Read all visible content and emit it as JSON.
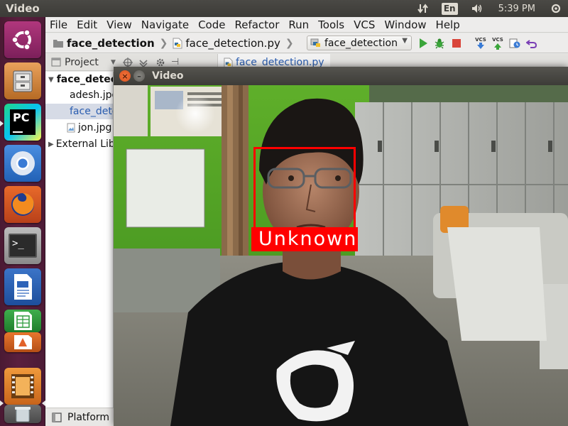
{
  "top_panel": {
    "title": "Video",
    "lang": "En",
    "time": "5:39 PM"
  },
  "launcher": {
    "items": [
      {
        "name": "dash-home",
        "icon": "ubuntu-logo-icon"
      },
      {
        "name": "files",
        "icon": "file-cabinet-icon"
      },
      {
        "name": "pycharm",
        "icon": "pycharm-icon",
        "label": "PC"
      },
      {
        "name": "chromium",
        "icon": "chromium-icon"
      },
      {
        "name": "firefox",
        "icon": "firefox-icon"
      },
      {
        "name": "terminal",
        "icon": "terminal-icon",
        "label": ">_"
      },
      {
        "name": "writer",
        "icon": "libreoffice-writer-icon"
      },
      {
        "name": "calc",
        "icon": "libreoffice-calc-icon"
      },
      {
        "name": "impress",
        "icon": "libreoffice-impress-icon"
      },
      {
        "name": "videos",
        "icon": "video-player-icon"
      }
    ]
  },
  "ide": {
    "menu": [
      "File",
      "Edit",
      "View",
      "Navigate",
      "Code",
      "Refactor",
      "Run",
      "Tools",
      "VCS",
      "Window",
      "Help"
    ],
    "breadcrumb": {
      "project": "face_detection",
      "file": "face_detection.py"
    },
    "run_config": "face_detection",
    "toolbar": {
      "vcs1": "VCS",
      "vcs2": "VCS"
    },
    "project_tab": "Project",
    "editor_tab": "face_detection.py",
    "tree": {
      "root": "face_detection",
      "items": [
        "adesh.jpg",
        "face_detection.py",
        "jon.jpg"
      ],
      "external": "External Libraries"
    },
    "bottom": "Platform"
  },
  "video_window": {
    "title": "Video",
    "face_label": "Unknown",
    "colors": {
      "box": "#ff0000",
      "label_text": "#ffffff"
    }
  }
}
